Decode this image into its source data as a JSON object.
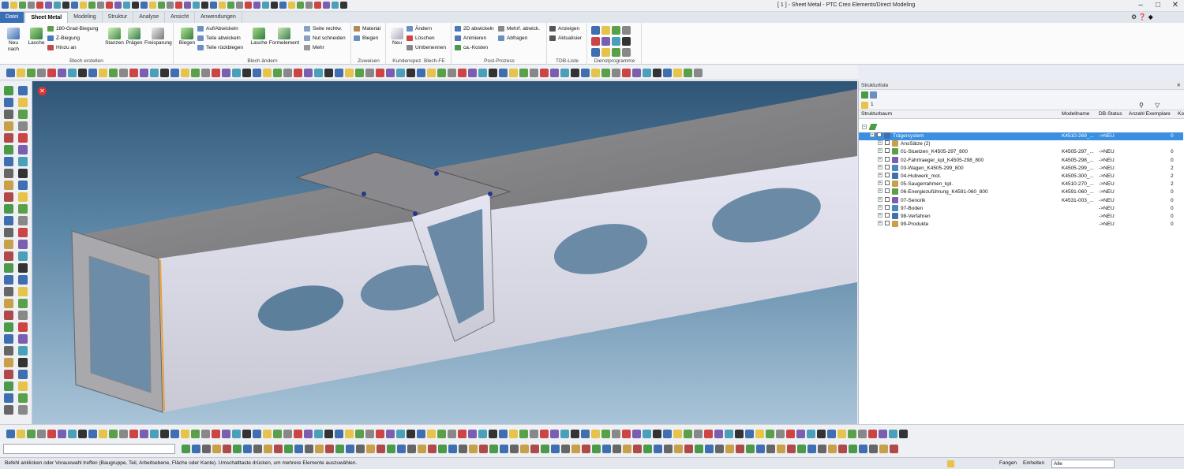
{
  "window": {
    "title": "[ 1 ] - Sheet Metal - PTC Creo Elements/Direct Modeling",
    "minimize": "–",
    "maximize": "□",
    "close": "✕"
  },
  "tabs": [
    "Datei",
    "Sheet Metal",
    "Modeling",
    "Struktur",
    "Analyse",
    "Ansicht",
    "Anwendungen"
  ],
  "ribbon": {
    "blech_erstellen": {
      "label": "Blech erstellen",
      "neu": "Neu",
      "neu_sub": "nach",
      "lasche": "Lasche",
      "grad180": "180-Grad-Biegung",
      "zbiegung": "Z-Biegung",
      "hinzu": "Hinzu an",
      "stanzen": "Stanzen",
      "praegen": "Prägen",
      "freisparung": "Freisparung"
    },
    "blech_aendern": {
      "label": "Blech ändern",
      "biegen": "Biegen",
      "auf_abwickeln": "Auf/Abwickeln",
      "teile_abwickeln": "Teile abwickeln",
      "teile_rueck": "Teile rückbiegen",
      "lasche": "Lasche",
      "formelement": "Formelement",
      "seite": "Seite rechtw.",
      "nut": "Nut schneiden",
      "mehr": "Mehr"
    },
    "zuweisen": {
      "label": "Zuweisen",
      "material": "Material",
      "biegen": "Biegen"
    },
    "kundenspez": {
      "label": "Kundenspez. Blech-FE",
      "neu": "Neu",
      "aendern": "Ändern",
      "loeschen": "Löschen",
      "umbenennen": "Umbenennen"
    },
    "post": {
      "label": "Post-Prozess",
      "abwickeln2d": "2D abwickeln",
      "animieren": "Animieren",
      "kosten": "ca.-Kosten",
      "mehrf": "Mehrf. abwick.",
      "abfragen": "Abfragen"
    },
    "tdb": {
      "label": "TDB-Liste",
      "anzeigen": "Anzeigen",
      "aktualisier": "Aktualisier"
    },
    "dienst": {
      "label": "Dienstprogramme"
    }
  },
  "panel": {
    "title": "Strukturliste",
    "counter": "1",
    "columns": [
      "Strukturbaum",
      "Modellname",
      "DB-Status",
      "Anzahl Exemplare",
      "Ko"
    ],
    "rows": [
      {
        "name": "Trägersystem",
        "model": "K4510-269_...",
        "status": "->NEU",
        "count": "0",
        "selected": true,
        "level": 1
      },
      {
        "name": "AnsSätze (2)",
        "model": "",
        "status": "",
        "count": "",
        "level": 2
      },
      {
        "name": "01-Stuetzen_K4505-297_800",
        "model": "K4505-297_...",
        "status": "->NEU",
        "count": "0",
        "level": 2
      },
      {
        "name": "02-Fahrtraeger_kpl_K4505-298_800",
        "model": "K4505-298_...",
        "status": "->NEU",
        "count": "0",
        "level": 2
      },
      {
        "name": "03-Wagen_K4505-299_800",
        "model": "K4505-299_...",
        "status": "->NEU",
        "count": "2",
        "level": 2
      },
      {
        "name": "04-Hubwerk_mot.",
        "model": "K4505-300_...",
        "status": "->NEU",
        "count": "2",
        "level": 2
      },
      {
        "name": "05-Saugerrahmen_kpl.",
        "model": "K4510-270_...",
        "status": "->NEU",
        "count": "2",
        "level": 2
      },
      {
        "name": "06-Energiezuführung_K4591-060_800",
        "model": "K4591-060_...",
        "status": "->NEU",
        "count": "0",
        "level": 2
      },
      {
        "name": "07-Senorik",
        "model": "K4531-003_...",
        "status": "->NEU",
        "count": "0",
        "level": 2
      },
      {
        "name": "97-Boden",
        "model": "",
        "status": "->NEU",
        "count": "0",
        "level": 2
      },
      {
        "name": "98-Verfahren",
        "model": "",
        "status": "->NEU",
        "count": "0",
        "level": 2
      },
      {
        "name": "99-Produkte",
        "model": "",
        "status": "->NEU",
        "count": "0",
        "level": 2
      }
    ]
  },
  "status": {
    "message": "Befehl anklicken oder Vorauswahl treffen (Baugruppe, Teil, Arbeitsebene, Fläche oder Kante). Umschalttaste drücken, um mehrere Elemente auszuwählen.",
    "fangen": "Fangen",
    "einheiten": "Einheiten",
    "alle": "Alle"
  },
  "icons": {
    "close_view": "close-icon",
    "search": "binoculars-icon",
    "filter": "filter-icon"
  }
}
